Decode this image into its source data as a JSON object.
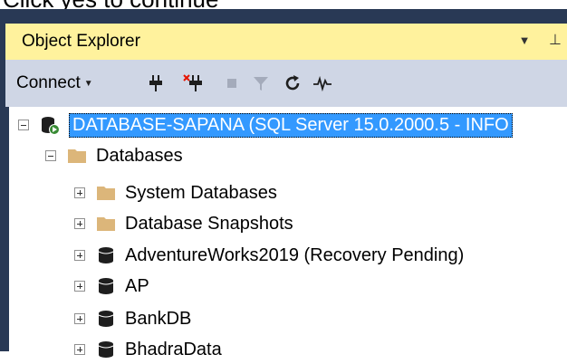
{
  "caption": "Click yes to continue",
  "panel": {
    "title": "Object Explorer",
    "dropdown_glyph": "▼",
    "pin_glyph": "⊥"
  },
  "toolbar": {
    "connect_label": "Connect",
    "connect_caret": "▼",
    "icons": [
      "connect-plug-icon",
      "disconnect-plug-icon",
      "stop-icon",
      "filter-icon",
      "refresh-icon",
      "activity-monitor-icon"
    ]
  },
  "tree": {
    "server": "DATABASE-SAPANA (SQL Server 15.0.2000.5 - INFO",
    "databases": "Databases",
    "children": [
      {
        "label": "System Databases",
        "icon": "folder-icon"
      },
      {
        "label": "Database Snapshots",
        "icon": "folder-icon"
      },
      {
        "label": "AdventureWorks2019 (Recovery Pending)",
        "icon": "database-icon"
      },
      {
        "label": "AP",
        "icon": "database-icon"
      },
      {
        "label": "BankDB",
        "icon": "database-icon"
      },
      {
        "label": "BhadraData",
        "icon": "database-icon"
      }
    ]
  },
  "colors": {
    "frame": "#293955",
    "title_bar": "#fff29d",
    "toolbar": "#cfd6e5",
    "selection": "#3399ff",
    "folder": "#dcb67a"
  }
}
